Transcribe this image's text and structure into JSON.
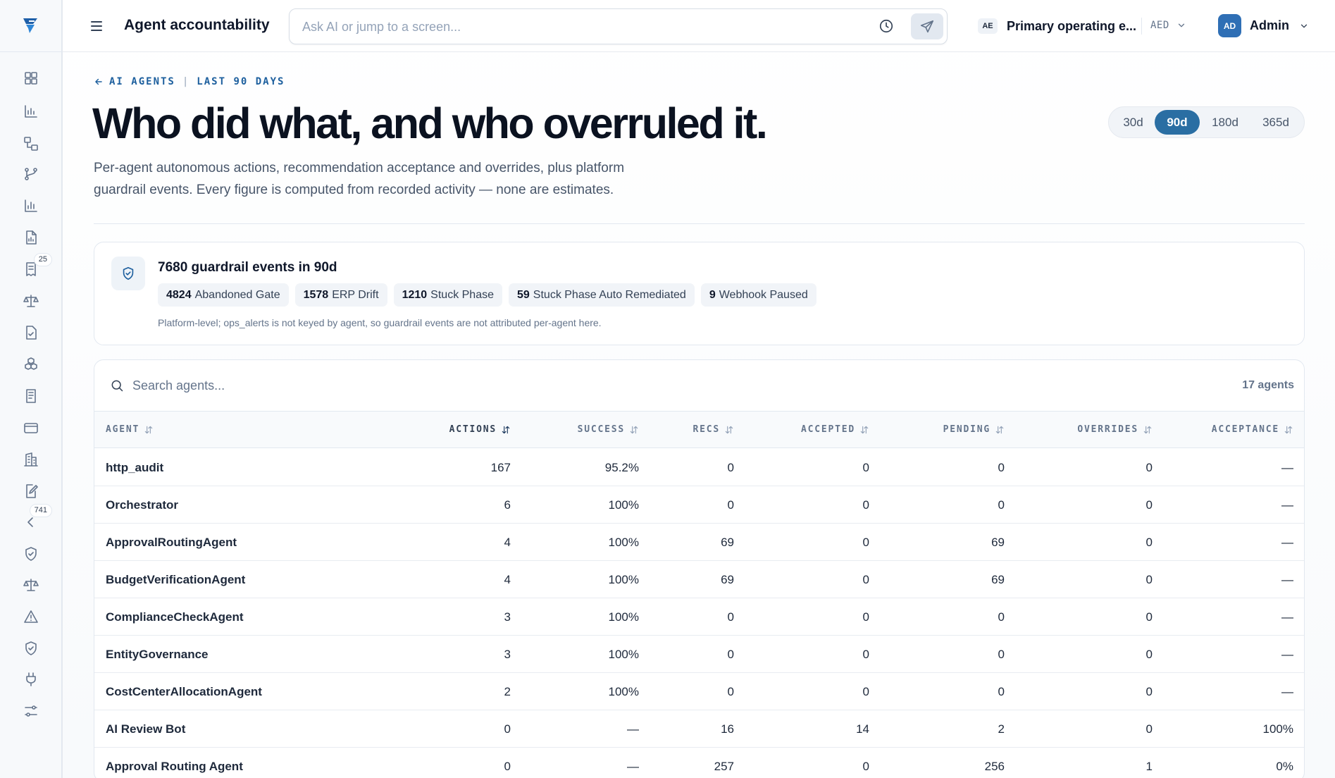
{
  "topbar": {
    "title": "Agent accountability",
    "search_placeholder": "Ask AI or jump to a screen...",
    "entity_code": "AE",
    "entity_name": "Primary operating e...",
    "currency": "AED",
    "user_initials": "AD",
    "user_name": "Admin"
  },
  "sidebar": {
    "badges": {
      "ap_inbox": "25",
      "approvals": "741"
    },
    "icons": [
      "dashboard-icon",
      "bar-chart-icon",
      "workflow-icon",
      "git-branch-icon",
      "analytics-icon",
      "document-icon",
      "receipt-icon",
      "scale-icon",
      "file-check-icon",
      "boxes-icon",
      "ledger-icon",
      "credit-card-icon",
      "building-icon",
      "edit-document-icon",
      "chevron-icon",
      "shield-check-icon",
      "balance-icon",
      "alert-triangle-icon",
      "shield-icon",
      "plug-icon",
      "sliders-icon"
    ]
  },
  "breadcrumb": {
    "section": "AI AGENTS",
    "period": "LAST 90 DAYS"
  },
  "headline": "Who did what, and who overruled it.",
  "intro": "Per-agent autonomous actions, recommendation acceptance and overrides, plus platform guardrail events. Every figure is computed from recorded activity — none are estimates.",
  "range": {
    "options": [
      "30d",
      "90d",
      "180d",
      "365d"
    ],
    "selected": "90d"
  },
  "guardrails": {
    "title": "7680 guardrail events in 90d",
    "pills": [
      {
        "count": "4824",
        "label": "Abandoned Gate"
      },
      {
        "count": "1578",
        "label": "ERP Drift"
      },
      {
        "count": "1210",
        "label": "Stuck Phase"
      },
      {
        "count": "59",
        "label": "Stuck Phase Auto Remediated"
      },
      {
        "count": "9",
        "label": "Webhook Paused"
      }
    ],
    "note": "Platform-level; ops_alerts is not keyed by agent, so guardrail events are not attributed per-agent here."
  },
  "table": {
    "search_placeholder": "Search agents...",
    "count": "17 agents",
    "columns": [
      "AGENT",
      "ACTIONS",
      "SUCCESS",
      "RECS",
      "ACCEPTED",
      "PENDING",
      "OVERRIDES",
      "ACCEPTANCE"
    ],
    "sorted_column": "ACTIONS",
    "rows": [
      [
        "http_audit",
        "167",
        "95.2%",
        "0",
        "0",
        "0",
        "0",
        "—"
      ],
      [
        "Orchestrator",
        "6",
        "100%",
        "0",
        "0",
        "0",
        "0",
        "—"
      ],
      [
        "ApprovalRoutingAgent",
        "4",
        "100%",
        "69",
        "0",
        "69",
        "0",
        "—"
      ],
      [
        "BudgetVerificationAgent",
        "4",
        "100%",
        "69",
        "0",
        "69",
        "0",
        "—"
      ],
      [
        "ComplianceCheckAgent",
        "3",
        "100%",
        "0",
        "0",
        "0",
        "0",
        "—"
      ],
      [
        "EntityGovernance",
        "3",
        "100%",
        "0",
        "0",
        "0",
        "0",
        "—"
      ],
      [
        "CostCenterAllocationAgent",
        "2",
        "100%",
        "0",
        "0",
        "0",
        "0",
        "—"
      ],
      [
        "AI Review Bot",
        "0",
        "—",
        "16",
        "14",
        "2",
        "0",
        "100%"
      ],
      [
        "Approval Routing Agent",
        "0",
        "—",
        "257",
        "0",
        "256",
        "1",
        "0%"
      ]
    ]
  }
}
